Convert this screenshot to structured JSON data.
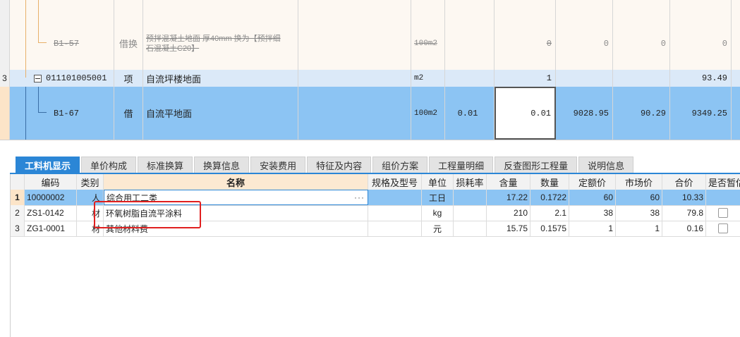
{
  "upper": {
    "rows": [
      {
        "seq": "",
        "code": "B1-57",
        "type": "借换",
        "name_line1": "预拌混凝土地面 厚40mm  换为【预拌细",
        "name_line2": "石混凝土C20】",
        "unit": "100m2",
        "quantity_expr": "",
        "quantity": "0",
        "unit_price": "0",
        "total": "0",
        "combined_price": "0"
      },
      {
        "seq": "3",
        "code": "011101005001",
        "type": "项",
        "name": "自流坪楼地面",
        "unit": "m2",
        "quantity_expr": "",
        "quantity": "1",
        "unit_price": "",
        "total": "",
        "combined_price": "93.49"
      },
      {
        "seq": "",
        "code": "B1-67",
        "type": "借",
        "name": "自流平地面",
        "unit": "100m2",
        "quantity_expr": "0.01",
        "quantity": "0.01",
        "unit_price": "9028.95",
        "total": "90.29",
        "combined_price": "9349.25"
      }
    ]
  },
  "tabs": [
    "工料机显示",
    "单价构成",
    "标准换算",
    "换算信息",
    "安装费用",
    "特征及内容",
    "组价方案",
    "工程量明细",
    "反查图形工程量",
    "说明信息"
  ],
  "lower": {
    "headers": [
      "编码",
      "类别",
      "名称",
      "规格及型号",
      "单位",
      "损耗率",
      "含量",
      "数量",
      "定额价",
      "市场价",
      "合价",
      "是否暂估"
    ],
    "rows": [
      {
        "seq": "1",
        "code": "10000002",
        "cat": "人",
        "name": "综合用工二类",
        "spec": "",
        "unit": "工日",
        "loss": "",
        "content": "17.22",
        "qty": "0.1722",
        "quota_price": "60",
        "market_price": "60",
        "total": "10.33"
      },
      {
        "seq": "2",
        "code": "ZS1-0142",
        "cat": "材",
        "name": "环氧树脂自流平涂料",
        "spec": "",
        "unit": "kg",
        "loss": "",
        "content": "210",
        "qty": "2.1",
        "quota_price": "38",
        "market_price": "38",
        "total": "79.8"
      },
      {
        "seq": "3",
        "code": "ZG1-0001",
        "cat": "材",
        "name": "其他材料费",
        "spec": "",
        "unit": "元",
        "loss": "",
        "content": "15.75",
        "qty": "0.1575",
        "quota_price": "1",
        "market_price": "1",
        "total": "0.16"
      }
    ],
    "ellipsis": "···"
  },
  "colors": {
    "selected_row": "#8cc4f3",
    "header_row": "#dbe9f8",
    "active_tab": "#2b86d6",
    "tree_line": "#e8b06a",
    "annotation": "#e02020"
  }
}
